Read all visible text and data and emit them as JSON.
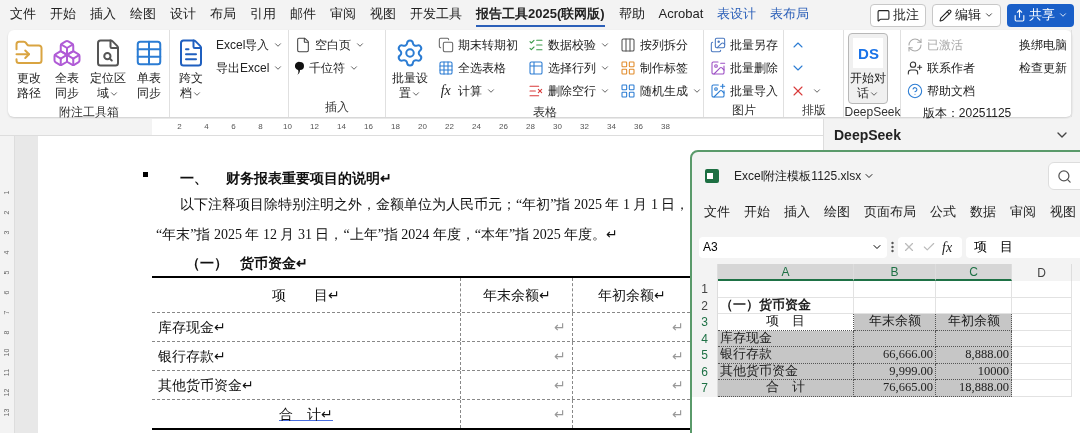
{
  "menu_tabs": [
    {
      "label": "文件",
      "selected": false,
      "kind": "normal"
    },
    {
      "label": "开始",
      "selected": false,
      "kind": "normal"
    },
    {
      "label": "插入",
      "selected": false,
      "kind": "normal"
    },
    {
      "label": "绘图",
      "selected": false,
      "kind": "normal"
    },
    {
      "label": "设计",
      "selected": false,
      "kind": "normal"
    },
    {
      "label": "布局",
      "selected": false,
      "kind": "normal"
    },
    {
      "label": "引用",
      "selected": false,
      "kind": "normal"
    },
    {
      "label": "邮件",
      "selected": false,
      "kind": "normal"
    },
    {
      "label": "审阅",
      "selected": false,
      "kind": "normal"
    },
    {
      "label": "视图",
      "selected": false,
      "kind": "normal"
    },
    {
      "label": "开发工具",
      "selected": false,
      "kind": "normal"
    },
    {
      "label": "报告工具2025(联网版)",
      "selected": true,
      "kind": "normal"
    },
    {
      "label": "帮助",
      "selected": false,
      "kind": "normal"
    },
    {
      "label": "Acrobat",
      "selected": false,
      "kind": "normal"
    },
    {
      "label": "表设计",
      "selected": false,
      "kind": "contextual"
    },
    {
      "label": "表布局",
      "selected": false,
      "kind": "contextual"
    }
  ],
  "top_buttons": [
    {
      "label": "批注",
      "kind": "comment"
    },
    {
      "label": "编辑",
      "kind": "edit"
    },
    {
      "label": "共享",
      "kind": "share"
    }
  ],
  "ribbon_groups": [
    {
      "label": "附注工具箱",
      "columns": [
        [
          {
            "kind": "large",
            "lines": [
              "更改",
              "路径"
            ],
            "dropdown": false
          }
        ],
        [
          {
            "kind": "large",
            "lines": [
              "全表",
              "同步"
            ],
            "dropdown": false
          }
        ],
        [
          {
            "kind": "large",
            "lines": [
              "定位区",
              "域"
            ],
            "dropdown": true
          }
        ],
        [
          {
            "kind": "large",
            "lines": [
              "单表",
              "同步"
            ],
            "dropdown": false
          }
        ]
      ]
    },
    {
      "columns": [
        [
          {
            "kind": "large",
            "lines": [
              "跨文",
              "档"
            ],
            "dropdown": true
          }
        ],
        [
          {
            "kind": "small",
            "label": "Excel导入",
            "dropdown": true
          },
          {
            "kind": "small",
            "label": "导出Excel",
            "dropdown": true
          }
        ]
      ]
    },
    {
      "label": "插入",
      "columns": [
        [
          {
            "kind": "small",
            "label": "空白页",
            "dropdown": true
          },
          {
            "kind": "small",
            "label": "千位符",
            "dropdown": true
          }
        ]
      ]
    },
    {
      "label": "表格",
      "columns": [
        [
          {
            "kind": "large",
            "lines": [
              "批量设",
              "置"
            ],
            "dropdown": true
          }
        ],
        [
          {
            "kind": "small",
            "label": "期末转期初",
            "dropdown": false
          },
          {
            "kind": "small",
            "label": "全选表格",
            "dropdown": false
          },
          {
            "kind": "small",
            "label": "计算",
            "dropdown": true,
            "icon_glyph": "fx"
          }
        ],
        [
          {
            "kind": "small",
            "label": "数据校验",
            "dropdown": true
          },
          {
            "kind": "small",
            "label": "选择行列",
            "dropdown": true
          },
          {
            "kind": "small",
            "label": "删除空行",
            "dropdown": true
          }
        ],
        [
          {
            "kind": "small",
            "label": "按列拆分",
            "dropdown": false
          },
          {
            "kind": "small",
            "label": "制作标签",
            "dropdown": false
          },
          {
            "kind": "small",
            "label": "随机生成",
            "dropdown": true
          }
        ]
      ]
    },
    {
      "label": "图片",
      "columns": [
        [
          {
            "kind": "small",
            "label": "批量另存",
            "dropdown": false
          },
          {
            "kind": "small",
            "label": "批量删除",
            "dropdown": false
          },
          {
            "kind": "small",
            "label": "批量导入",
            "dropdown": false
          }
        ]
      ]
    },
    {
      "label": "排版",
      "columns": [
        [
          {
            "kind": "icon",
            "dropdown": false
          },
          {
            "kind": "icon",
            "dropdown": false
          },
          {
            "kind": "icon",
            "dropdown": true
          }
        ]
      ]
    },
    {
      "label": "DeepSeek",
      "columns": [
        [
          {
            "kind": "large",
            "lines": [
              "开始对",
              "话"
            ],
            "dropdown": true,
            "pressed": true,
            "icon_glyph": "DS"
          }
        ]
      ]
    },
    {
      "columns": [
        [
          {
            "kind": "small",
            "label": "已激活",
            "dropdown": false,
            "disabled": true
          },
          {
            "kind": "small",
            "label": "联系作者",
            "dropdown": false,
            "disabled": false
          },
          {
            "kind": "small",
            "label": "帮助文档",
            "dropdown": false,
            "disabled": false
          },
          {
            "kind": "text",
            "label": "版本：20251125"
          }
        ],
        [
          {
            "kind": "small",
            "label": "换绑电脑",
            "dropdown": false,
            "disabled": false
          },
          {
            "kind": "small",
            "label": "检查更新",
            "dropdown": false,
            "disabled": false
          }
        ]
      ]
    }
  ],
  "ruler": {
    "marks": [
      "2",
      "4",
      "6",
      "8",
      "10",
      "12",
      "14",
      "16",
      "18",
      "20",
      "22",
      "24",
      "26",
      "28",
      "30",
      "32",
      "34",
      "36",
      "38"
    ]
  },
  "vertical_ruler": {
    "marks": [
      "1",
      "2",
      "3",
      "4",
      "5",
      "6",
      "7",
      "8",
      "10",
      "11",
      "12",
      "13"
    ]
  },
  "document": {
    "heading": {
      "number": "一、",
      "text": "财务报表重要项目的说明↵"
    },
    "paragraph_lines": [
      "以下注释项目除特别注明之外，金额单位为人民币元；“年初”指 2025 年 1 月 1 日，",
      "“年末”指 2025 年 12 月 31 日，“上年”指 2024 年度，“本年”指 2025 年度。↵"
    ],
    "subheading": {
      "number": "（一）",
      "text": "货币资金↵"
    },
    "table": {
      "rows": [
        {
          "kind": "header",
          "cells": [
            "项　　目↵",
            "年末余额↵",
            "年初余额↵"
          ]
        },
        {
          "kind": "item",
          "cells": [
            "库存现金↵",
            "↵",
            "↵"
          ]
        },
        {
          "kind": "item",
          "cells": [
            "银行存款↵",
            "↵",
            "↵"
          ]
        },
        {
          "kind": "item",
          "cells": [
            "其他货币资金↵",
            "↵",
            "↵"
          ]
        },
        {
          "kind": "total",
          "cells": [
            "合　计↵",
            "↵",
            "↵"
          ]
        }
      ]
    }
  },
  "side_pane": {
    "title": "DeepSeek"
  },
  "excel": {
    "title": "Excel附注模板1125.xlsx",
    "tabs": [
      "文件",
      "开始",
      "插入",
      "绘图",
      "页面布局",
      "公式",
      "数据",
      "审阅",
      "视图"
    ],
    "name_box": "A3",
    "formula_glyph": "fx",
    "formula": "项　目",
    "columns": [
      {
        "label": "A",
        "selected": true
      },
      {
        "label": "B",
        "selected": true
      },
      {
        "label": "C",
        "selected": true
      },
      {
        "label": "D",
        "selected": false
      }
    ],
    "rows": [
      {
        "label": "1",
        "kind": "empty",
        "selected": false,
        "cells": []
      },
      {
        "label": "2",
        "kind": "title",
        "selected": false,
        "cells": [
          {
            "text": "（一）货币资金",
            "active": false
          }
        ]
      },
      {
        "label": "3",
        "kind": "header",
        "selected": true,
        "cells": [
          {
            "text": "项　目",
            "active": true
          },
          {
            "text": "年末余额",
            "active": false
          },
          {
            "text": "年初余额",
            "active": false
          }
        ]
      },
      {
        "label": "4",
        "kind": "item",
        "selected": true,
        "cells": [
          {
            "text": "库存现金",
            "active": false
          }
        ]
      },
      {
        "label": "5",
        "kind": "item",
        "selected": true,
        "cells": [
          {
            "text": "银行存款",
            "active": false
          },
          {
            "text": "66,666.00",
            "active": false
          },
          {
            "text": "8,888.00",
            "active": false
          }
        ]
      },
      {
        "label": "6",
        "kind": "item",
        "selected": true,
        "cells": [
          {
            "text": "其他货币资金",
            "active": false
          },
          {
            "text": "9,999.00",
            "active": false
          },
          {
            "text": "10000",
            "active": false
          }
        ]
      },
      {
        "label": "7",
        "kind": "total",
        "selected": true,
        "cells": [
          {
            "text": "合　计",
            "active": false
          },
          {
            "text": "76,665.00",
            "active": false
          },
          {
            "text": "18,888.00",
            "active": false
          }
        ]
      }
    ]
  }
}
